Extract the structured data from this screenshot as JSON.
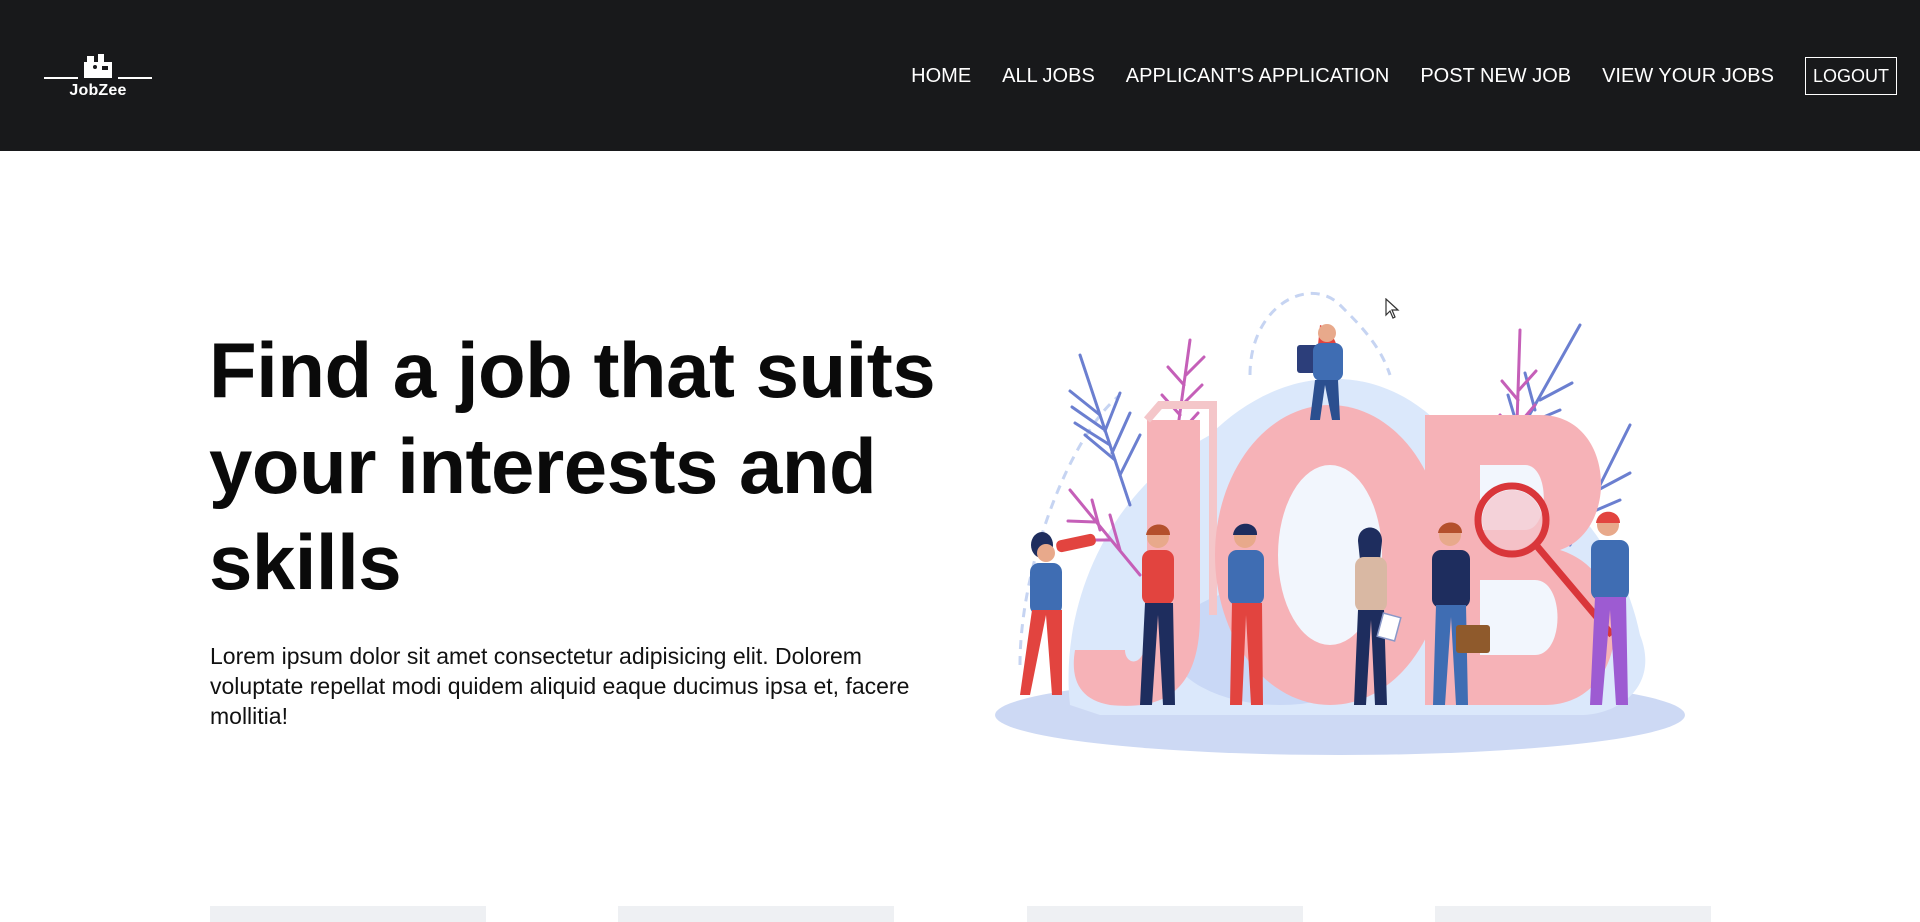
{
  "brand": {
    "name": "JobZee"
  },
  "nav": {
    "links": [
      "Home",
      "All Jobs",
      "Applicant's Application",
      "Post New Job",
      "View Your Jobs"
    ],
    "logout_label": "LOGOUT"
  },
  "hero": {
    "title": "Find a job that suits your interests and skills",
    "description": "Lorem ipsum dolor sit amet consectetur adipisicing elit. Dolorem voluptate repellat modi quidem aliquid eaque ducimus ipsa et, facere mollitia!",
    "illustration_letters": "JOB"
  },
  "colors": {
    "navbar_bg": "#18191b",
    "letters_pink": "#f7aeb5",
    "blob_blue": "#dbe8fb",
    "card_bg": "#eef0f3"
  }
}
